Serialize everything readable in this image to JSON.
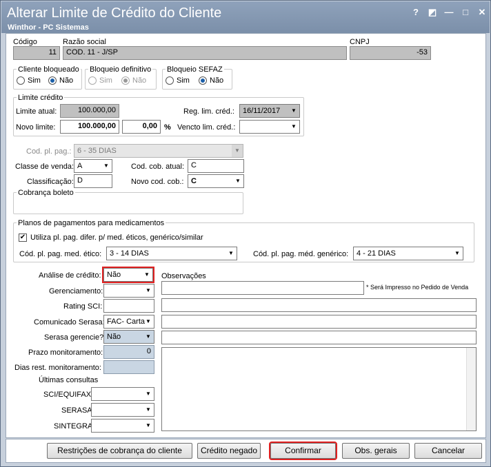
{
  "window": {
    "title": "Alterar Limite de Crédito do Cliente",
    "subtitle": "Winthor - PC Sistemas",
    "help": "?",
    "min": "—",
    "max": "□",
    "close": "✕",
    "restore": "◩"
  },
  "header": {
    "codigo_label": "Código",
    "codigo_value": "11",
    "razao_label": "Razão social",
    "razao_value": "COD. 11 - J/SP",
    "cnpj_label": "CNPJ",
    "cnpj_value": "-53"
  },
  "cliente_bloqueado": {
    "title": "Cliente bloqueado",
    "sim": "Sim",
    "nao": "Não",
    "selected": "nao"
  },
  "bloqueio_definitivo": {
    "title": "Bloqueio definitivo",
    "sim": "Sim",
    "nao": "Não",
    "selected": "nao"
  },
  "bloqueio_sefaz": {
    "title": "Bloqueio SEFAZ",
    "sim": "Sim",
    "nao": "Não",
    "selected": "nao"
  },
  "limite": {
    "title": "Limite crédito",
    "atual_label": "Limite atual:",
    "atual_value": "100.000,00",
    "novo_label": "Novo limite:",
    "novo_value": "100.000,00",
    "perc_value": "0,00",
    "perc_symbol": "%",
    "reg_label": "Reg. lim. créd.:",
    "reg_value": "16/11/2017",
    "vencto_label": "Vencto lim. créd.:",
    "vencto_value": ""
  },
  "venda": {
    "cod_pl_pag_label": "Cod. pl. pag.:",
    "cod_pl_pag_value": "6 - 35 DIAS",
    "classe_label": "Classe de venda:",
    "classe_value": "A",
    "cod_cob_atual_label": "Cod. cob. atual:",
    "cod_cob_atual_value": "C",
    "classificacao_label": "Classificação:",
    "classificacao_value": "D",
    "novo_cod_cob_label": "Novo cod. cob.:",
    "novo_cod_cob_value": "C",
    "cobranca_boleto_title": "Cobrança boleto"
  },
  "medicamentos": {
    "title": "Planos de pagamentos para medicamentos",
    "check_label": "Utiliza pl. pag. difer. p/ med. éticos, genérico/similar",
    "checked": "✔",
    "etico_label": "Cód. pl. pag. med. ético:",
    "etico_value": "3 - 14 DIAS",
    "generico_label": "Cód. pl. pag. méd. genérico:",
    "generico_value": "4 - 21 DIAS"
  },
  "analise": {
    "analise_label": "Análise de crédito:",
    "analise_value": "Não",
    "gerenciamento_label": "Gerenciamento:",
    "gerenciamento_value": "",
    "rating_label": "Rating SCI:",
    "rating_value": "",
    "comunicado_label": "Comunicado Serasa:",
    "comunicado_value": "FAC- Carta",
    "serasa_ger_label": "Serasa gerencie?",
    "serasa_ger_value": "Não",
    "prazo_label": "Prazo monitoramento:",
    "prazo_value": "0",
    "dias_label": "Dias rest. monitoramento:",
    "dias_value": "",
    "ultimas_label": "Últimas consultas",
    "sci_label": "SCI/EQUIFAX",
    "serasa_label": "SERASA",
    "sintegra_label": "SINTEGRA"
  },
  "obs": {
    "label": "Observações",
    "note": "* Será Impresso no Pedido de Venda"
  },
  "buttons": {
    "restricoes": "Restrições de cobrança do cliente",
    "credito_negado": "Crédito negado",
    "confirmar": "Confirmar",
    "obs_gerais": "Obs. gerais",
    "cancelar": "Cancelar"
  }
}
